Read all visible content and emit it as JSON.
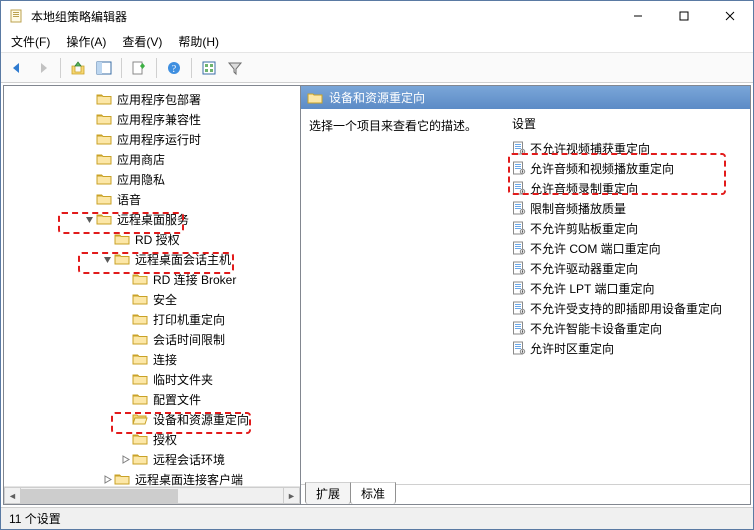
{
  "window": {
    "title": "本地组策略编辑器"
  },
  "menu": {
    "file": "文件(F)",
    "action": "操作(A)",
    "view": "查看(V)",
    "help": "帮助(H)"
  },
  "tree": {
    "items": [
      {
        "label": "应用程序包部署",
        "indent": "ind1",
        "twisty": ""
      },
      {
        "label": "应用程序兼容性",
        "indent": "ind1",
        "twisty": ""
      },
      {
        "label": "应用程序运行时",
        "indent": "ind1",
        "twisty": ""
      },
      {
        "label": "应用商店",
        "indent": "ind1",
        "twisty": ""
      },
      {
        "label": "应用隐私",
        "indent": "ind1",
        "twisty": ""
      },
      {
        "label": "语音",
        "indent": "ind1",
        "twisty": ""
      },
      {
        "label": "远程桌面服务",
        "indent": "ind1",
        "twisty": "v",
        "hl": true
      },
      {
        "label": "RD 授权",
        "indent": "ind2",
        "twisty": ""
      },
      {
        "label": "远程桌面会话主机",
        "indent": "ind2",
        "twisty": "v",
        "hl": true
      },
      {
        "label": "RD 连接 Broker",
        "indent": "ind3",
        "twisty": ""
      },
      {
        "label": "安全",
        "indent": "ind3",
        "twisty": ""
      },
      {
        "label": "打印机重定向",
        "indent": "ind3",
        "twisty": ""
      },
      {
        "label": "会话时间限制",
        "indent": "ind3",
        "twisty": ""
      },
      {
        "label": "连接",
        "indent": "ind3",
        "twisty": ""
      },
      {
        "label": "临时文件夹",
        "indent": "ind3",
        "twisty": ""
      },
      {
        "label": "配置文件",
        "indent": "ind3",
        "twisty": ""
      },
      {
        "label": "设备和资源重定向",
        "indent": "ind3",
        "twisty": "",
        "hl": true,
        "open": true
      },
      {
        "label": "授权",
        "indent": "ind3",
        "twisty": ""
      },
      {
        "label": "远程会话环境",
        "indent": "ind3",
        "twisty": ">"
      },
      {
        "label": "远程桌面连接客户端",
        "indent": "ind2",
        "twisty": ">"
      }
    ]
  },
  "right": {
    "header": "设备和资源重定向",
    "desc_prompt": "选择一个项目来查看它的描述。",
    "settings_header": "设置",
    "settings": [
      {
        "label": "不允许视频捕获重定向"
      },
      {
        "label": "允许音频和视频播放重定向",
        "hl_top": true
      },
      {
        "label": "允许音频录制重定向",
        "hl_bottom": true
      },
      {
        "label": "限制音频播放质量"
      },
      {
        "label": "不允许剪贴板重定向"
      },
      {
        "label": "不允许 COM 端口重定向"
      },
      {
        "label": "不允许驱动器重定向"
      },
      {
        "label": "不允许 LPT 端口重定向"
      },
      {
        "label": "不允许受支持的即插即用设备重定向"
      },
      {
        "label": "不允许智能卡设备重定向"
      },
      {
        "label": "允许时区重定向"
      }
    ]
  },
  "tabs": {
    "extended": "扩展",
    "standard": "标准"
  },
  "status": {
    "text": "11 个设置"
  }
}
